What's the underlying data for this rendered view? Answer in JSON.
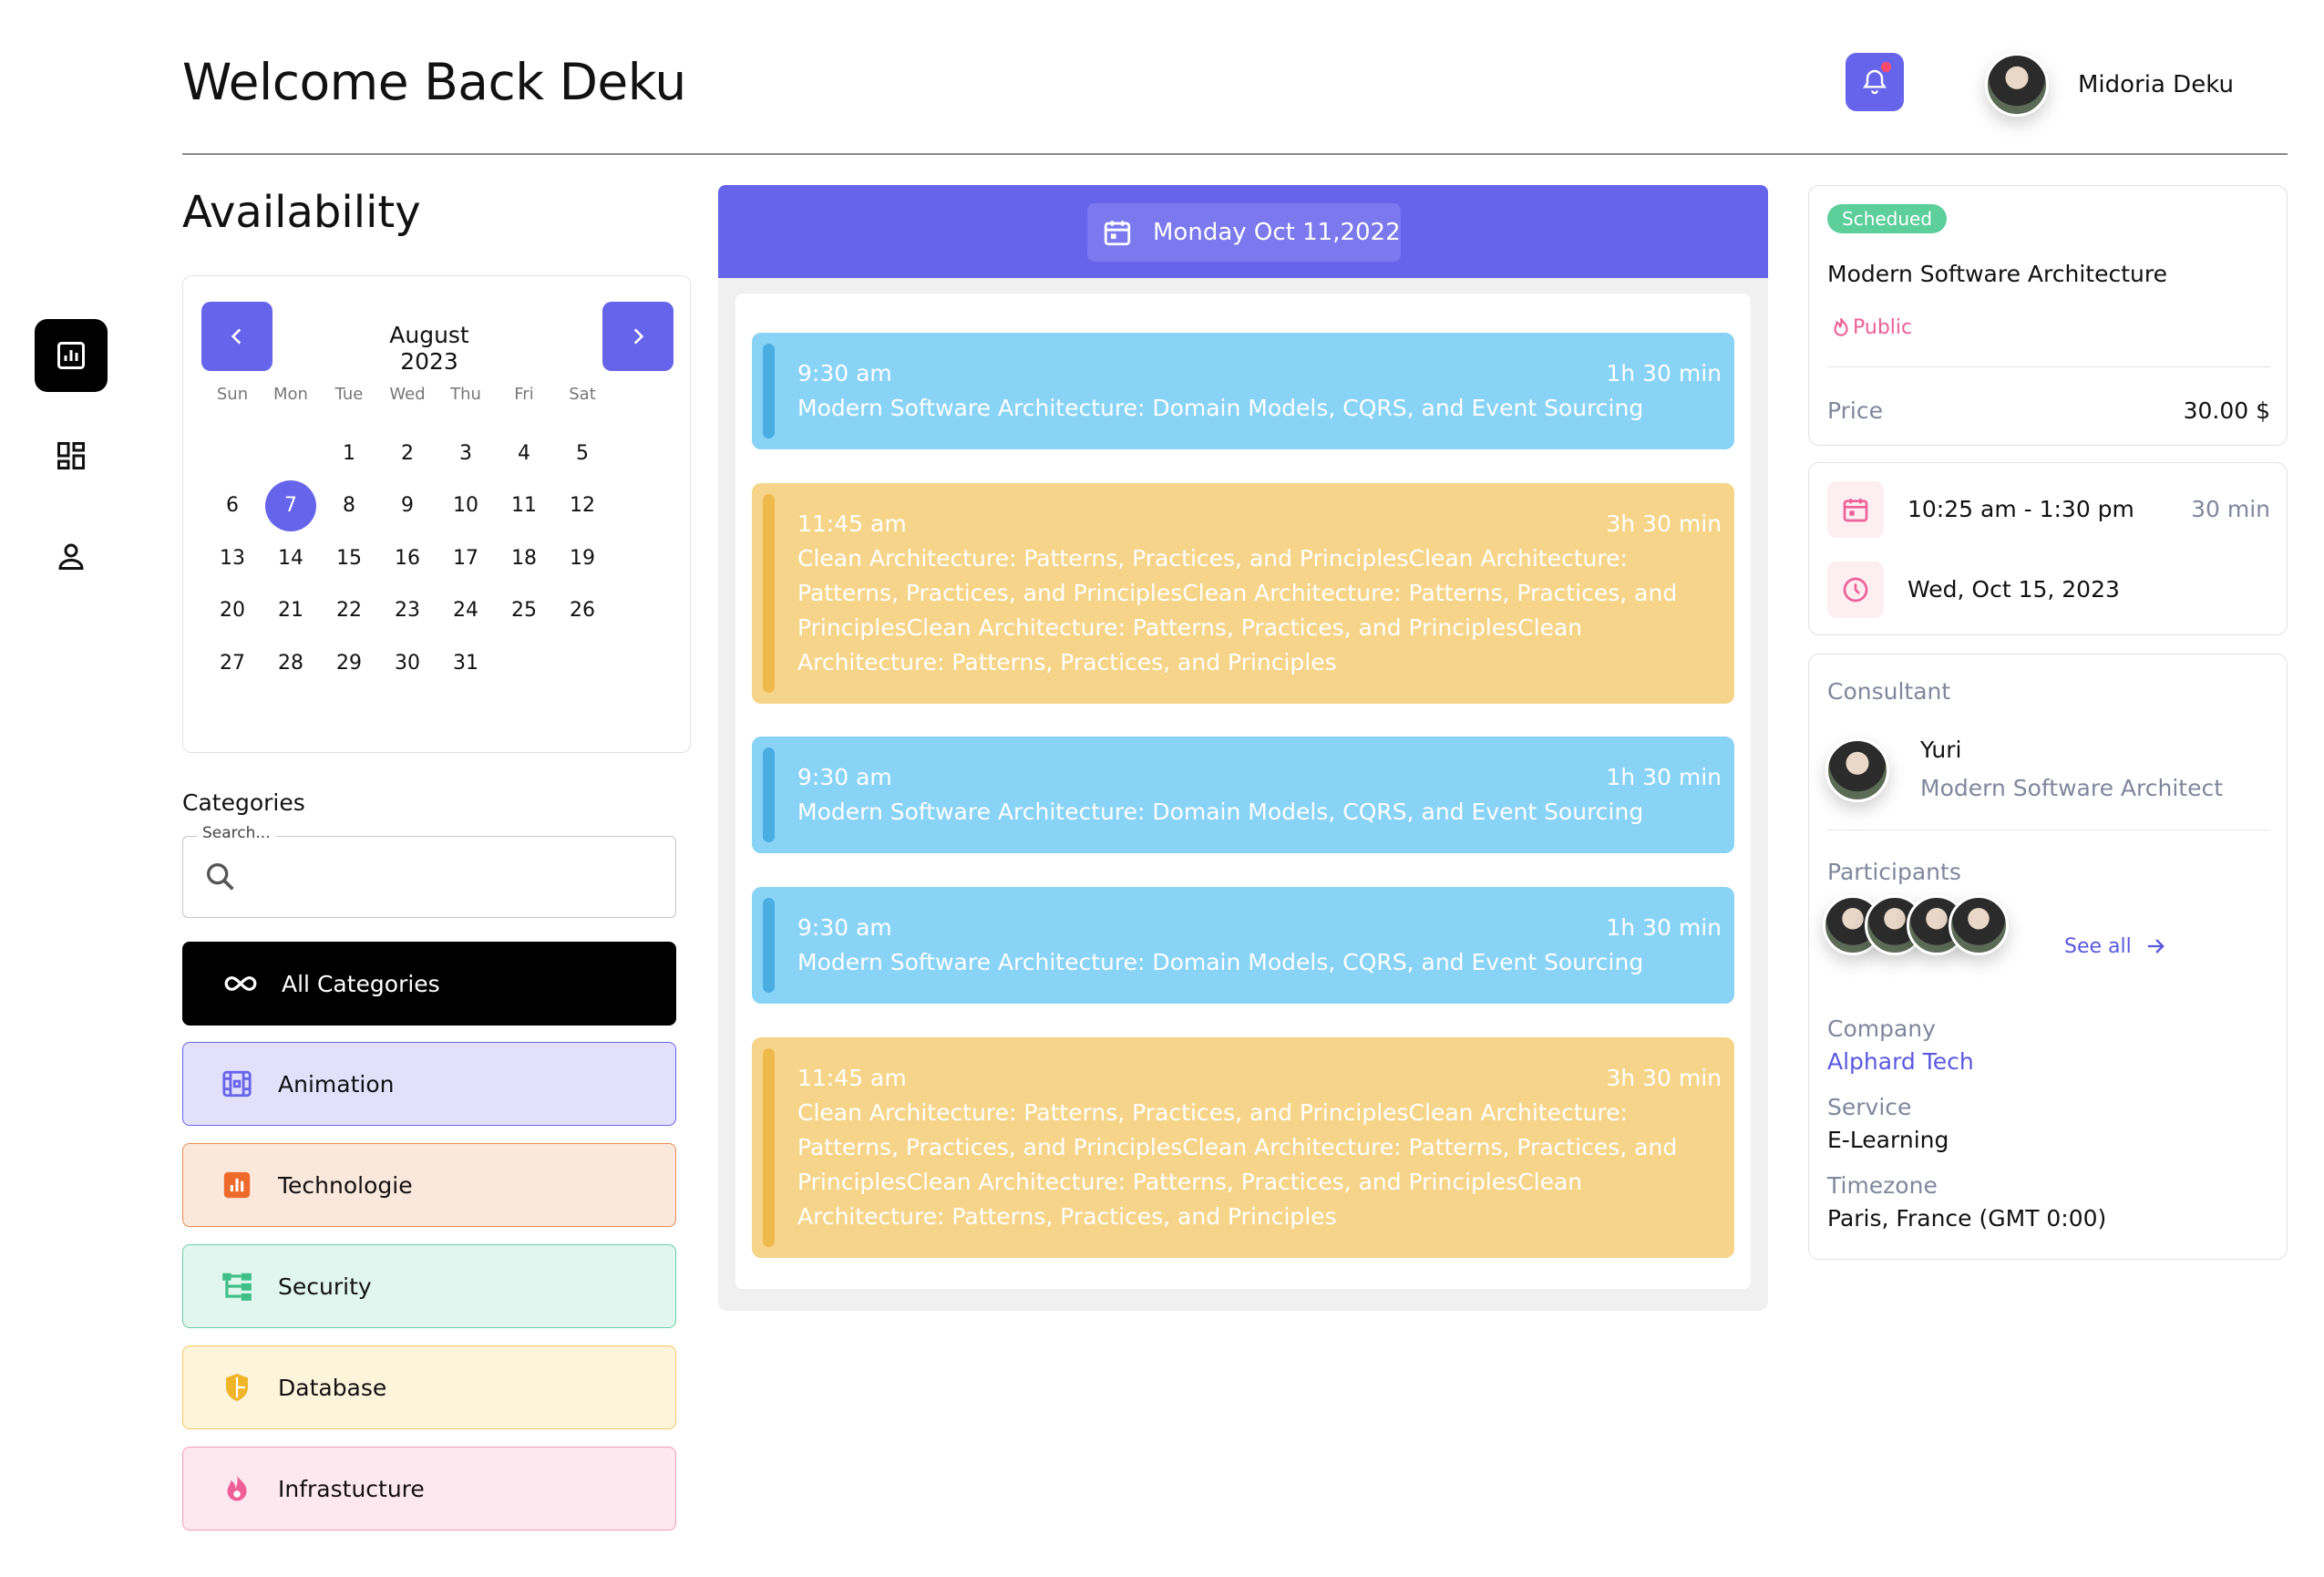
{
  "header": {
    "title": "Welcome Back Deku",
    "user_name": "Midoria Deku"
  },
  "availability": {
    "title": "Availability",
    "calendar": {
      "month_label": "August 2023",
      "weekdays": [
        "Sun",
        "Mon",
        "Tue",
        "Wed",
        "Thu",
        "Fri",
        "Sat"
      ],
      "selected_day": "7",
      "days": [
        "1",
        "2",
        "3",
        "4",
        "5",
        "6",
        "7",
        "8",
        "9",
        "10",
        "11",
        "12",
        "13",
        "14",
        "15",
        "16",
        "17",
        "18",
        "19",
        "20",
        "21",
        "22",
        "23",
        "24",
        "25",
        "26",
        "27",
        "28",
        "29",
        "30",
        "31"
      ]
    }
  },
  "categories": {
    "title": "Categories",
    "search_label": "Search...",
    "items": [
      {
        "label": "All Categories",
        "icon": "infinity-icon",
        "bg": "#000000",
        "border": "#000000",
        "fg": "#ffffff",
        "icon_color": "#ffffff"
      },
      {
        "label": "Animation",
        "icon": "film-icon",
        "bg": "#e3e0fb",
        "border": "#6664ea",
        "fg": "#111111",
        "icon_color": "#6664ea"
      },
      {
        "label": "Technologie",
        "icon": "chart-icon",
        "bg": "#fbe8dc",
        "border": "#ee8a4f",
        "fg": "#111111",
        "icon_color": "#ee6a2a"
      },
      {
        "label": "Security",
        "icon": "hierarchy-icon",
        "bg": "#e0f6ee",
        "border": "#6ccfa6",
        "fg": "#111111",
        "icon_color": "#3fbf88"
      },
      {
        "label": "Database",
        "icon": "shield-icon",
        "bg": "#fdf4dc",
        "border": "#f3c866",
        "fg": "#111111",
        "icon_color": "#f0b429"
      },
      {
        "label": "Infrastucture",
        "icon": "flame-icon",
        "bg": "#fde8f0",
        "border": "#f39abb",
        "fg": "#111111",
        "icon_color": "#ee5f97"
      }
    ]
  },
  "schedule": {
    "date_label": "Monday Oct 11,2022",
    "events": [
      {
        "time": "9:30 am",
        "duration": "1h 30 min",
        "title": "Modern Software Architecture: Domain Models, CQRS, and Event Sourcing",
        "color": "blue"
      },
      {
        "time": "11:45 am",
        "duration": "3h 30 min",
        "title": "Clean Architecture: Patterns, Practices, and PrinciplesClean Architecture: Patterns, Practices, and PrinciplesClean Architecture: Patterns, Practices, and PrinciplesClean Architecture: Patterns, Practices, and PrinciplesClean Architecture: Patterns, Practices, and Principles",
        "color": "yellow"
      },
      {
        "time": "9:30 am",
        "duration": "1h 30 min",
        "title": "Modern Software Architecture: Domain Models, CQRS, and Event Sourcing",
        "color": "blue"
      },
      {
        "time": "9:30 am",
        "duration": "1h 30 min",
        "title": "Modern Software Architecture: Domain Models, CQRS, and Event Sourcing",
        "color": "blue"
      },
      {
        "time": "11:45 am",
        "duration": "3h 30 min",
        "title": "Clean Architecture: Patterns, Practices, and PrinciplesClean Architecture: Patterns, Practices, and PrinciplesClean Architecture: Patterns, Practices, and PrinciplesClean Architecture: Patterns, Practices, and PrinciplesClean Architecture: Patterns, Practices, and Principles",
        "color": "yellow"
      }
    ]
  },
  "details": {
    "status": "Schedued",
    "title": "Modern Software Architecture",
    "visibility": "Public",
    "price_label": "Price",
    "price_value": "30.00 $",
    "time_range": "10:25 am - 1:30 pm",
    "time_duration": "30 min",
    "date": "Wed, Oct 15, 2023",
    "consultant_label": "Consultant",
    "consultant_name": "Yuri",
    "consultant_role": "Modern Software Architect",
    "participants_label": "Participants",
    "see_all": "See all",
    "company_label": "Company",
    "company_value": "Alphard Tech",
    "service_label": "Service",
    "service_value": "E-Learning",
    "timezone_label": "Timezone",
    "timezone_value": "Paris, France (GMT 0:00)"
  },
  "colors": {
    "accent": "#6664ea",
    "event_blue": "#89d3f6",
    "event_yellow": "#f6d58a",
    "status_green": "#5ccf9b",
    "pink": "#ee5f97"
  }
}
